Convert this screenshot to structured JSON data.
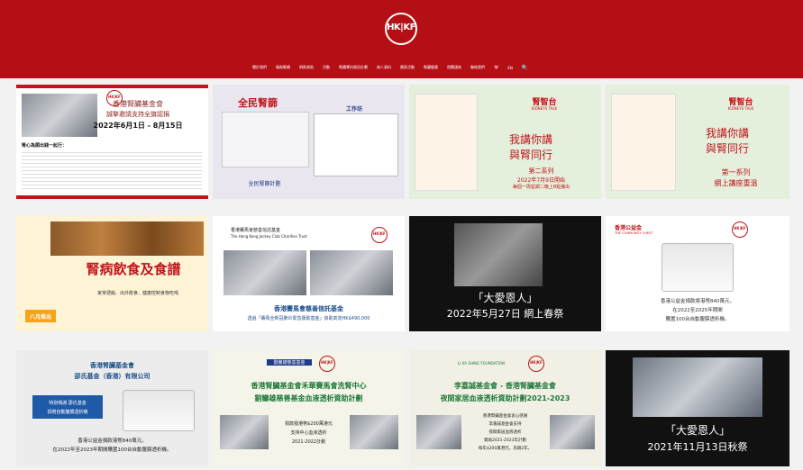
{
  "header": {
    "bg_color": "#b30f14",
    "logo_text": "HK|KF",
    "nav": [
      "關於我們",
      "服務範疇",
      "捐款資助",
      "活動",
      "腎臟專科資訊計劃",
      "病人資料",
      "籌款活動",
      "腎臟健康",
      "相關連結",
      "聯絡我們",
      "♥",
      "EN",
      "🔍"
    ]
  },
  "tiles": {
    "t1": {
      "title": "香港腎臟基金會",
      "subtitle": "誠摯邀請支持全旗認捐",
      "date": "2022年6月1日 - 8月15日",
      "body_heading": "腎心為閣出錢一起行："
    },
    "t2": {
      "title": "全民腎篩",
      "s1": "工作坊",
      "s2": "全民腎篩計劃"
    },
    "t3": {
      "brand": "腎智台",
      "brand_en": "KIDNEYS TALK",
      "main1": "我講你講",
      "main2": "與腎同行",
      "series": "第二系列",
      "airdate": "2022年7月9日開始",
      "airtime": "每個一周星期二晚上8點播出"
    },
    "t4": {
      "brand": "腎智台",
      "brand_en": "KIDNEYS TALK",
      "main1": "我講你講",
      "main2": "與腎同行",
      "series": "第一系列",
      "note": "網上講座重溫"
    },
    "t5": {
      "title": "腎病飲食及食譜",
      "badge": "八月推出",
      "sub": "家常便飯、出外飲食、健康控制食物吃喝"
    },
    "t6": {
      "org": "香港賽馬會慈善信託基金",
      "org_en": "The Hong Kong Jockey Club Charities Trust",
      "caption": "香港賽馬會慈善信託基金",
      "sub": "透過「賽馬全新冠肺炎緊急援助基金」資助高達HK$490,000"
    },
    "t7": {
      "title": "「大愛恩人」",
      "date": "2022年5月27日 網上春祭"
    },
    "t8": {
      "org": "香港公益金",
      "org_en": "THE COMMUNITY CHEST",
      "line1": "香港公益金捐款將港幣840萬元，",
      "line2": "在2022至2025年期間",
      "line3": "購置100台自動腹膜透析機。"
    },
    "t9": {
      "line1": "香港腎臟基金會",
      "line2": "邵氏基金（香港）有限公司",
      "box1": "特別鳴謝 邵氏基金",
      "box2": "捐贈自動腹膜透析機",
      "line3": "香港公益金捐款港幣840萬元，",
      "line4": "在2022年至2023年期間購置100台自動腹膜透析機。"
    },
    "t10": {
      "tag": "劉鑾雄慈善基金",
      "title1": "香港腎臟基金會禾華賽馬會洗腎中心",
      "title2": "劉鑾雄慈善基金血液透析資助計劃",
      "c1": "捐款撥港幣$200萬港元",
      "c2": "支持中心血液透析",
      "c3": "2021-2022計劃"
    },
    "t11": {
      "org": "LI KA SHING FOUNDATION",
      "title1": "李嘉誠基金會 - 香港腎臟基金會",
      "title2": "夜間家居血液透析資助計劃2021-2023",
      "c1": "香港腎臟基金會衷心感謝",
      "c2": "李嘉誠基金會支持",
      "c3": "夜間家居血液透析",
      "c4": "資助2021-2023年計劃",
      "c5": "每年$200萬港元，為期2年。"
    },
    "t12": {
      "title": "「大愛恩人」",
      "date": "2021年11月13日秋祭"
    }
  }
}
